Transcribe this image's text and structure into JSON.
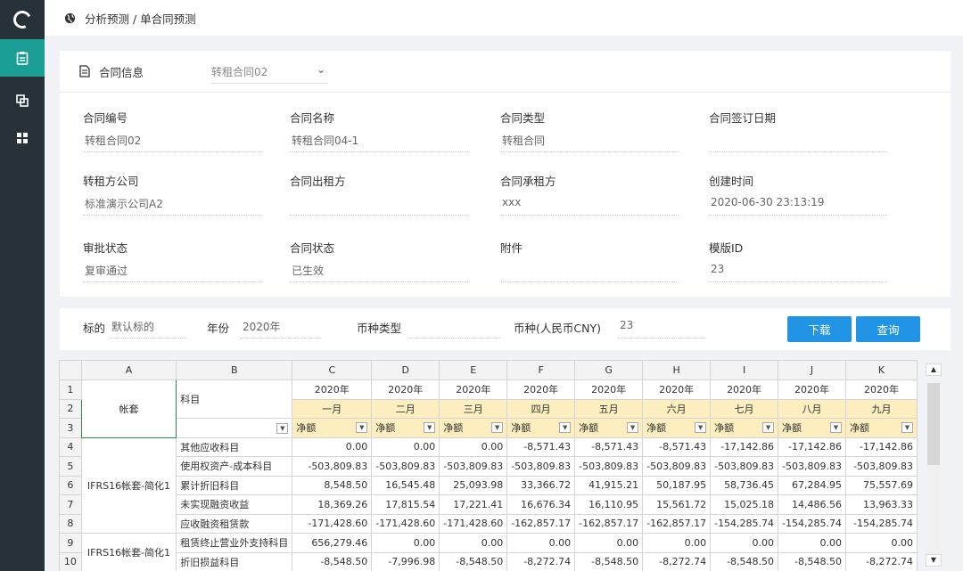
{
  "breadcrumb": "分析预测 / 单合同预测",
  "contract_card": {
    "title": "合同信息",
    "selector_value": "转租合同02",
    "fields": [
      {
        "label": "合同编号",
        "value": "转租合同02"
      },
      {
        "label": "合同名称",
        "value": "转租合同04-1"
      },
      {
        "label": "合同类型",
        "value": "转租合同"
      },
      {
        "label": "合同签订日期",
        "value": ""
      },
      {
        "label": "转租方公司",
        "value": "标准演示公司A2"
      },
      {
        "label": "合同出租方",
        "value": ""
      },
      {
        "label": "合同承租方",
        "value": "xxx"
      },
      {
        "label": "创建时间",
        "value": "2020-06-30 23:13:19"
      },
      {
        "label": "审批状态",
        "value": "复审通过"
      },
      {
        "label": "合同状态",
        "value": "已生效"
      },
      {
        "label": "附件",
        "value": ""
      },
      {
        "label": "模版ID",
        "value": "23"
      }
    ]
  },
  "filters": {
    "target_label": "标的",
    "target_value": "默认标的",
    "year_label": "年份",
    "year_value": "2020年",
    "currency_type_label": "币种类型",
    "currency_type_value": "",
    "currency_label": "币种(人民币CNY)",
    "currency_value": "23",
    "download_label": "下载",
    "query_label": "查询"
  },
  "sheet": {
    "columns": [
      "A",
      "B",
      "C",
      "D",
      "E",
      "F",
      "G",
      "H",
      "I",
      "J",
      "K"
    ],
    "row_numbers": [
      "1",
      "2",
      "3",
      "4",
      "5",
      "6",
      "7",
      "8",
      "9",
      "10"
    ],
    "a_header": "帐套",
    "b_header": "科目",
    "years": [
      "2020年",
      "2020年",
      "2020年",
      "2020年",
      "2020年",
      "2020年",
      "2020年",
      "2020年",
      "2020年"
    ],
    "months": [
      "一月",
      "二月",
      "三月",
      "四月",
      "五月",
      "六月",
      "七月",
      "八月",
      "九月"
    ],
    "measures": [
      "净额",
      "净额",
      "净额",
      "净额",
      "净额",
      "净额",
      "净额",
      "净额",
      "净额"
    ],
    "group1": "IFRS16帐套-简化1",
    "group2": "IFRS16帐套-简化1",
    "rows": [
      {
        "subject": "其他应收科目",
        "values": [
          "0.00",
          "0.00",
          "0.00",
          "-8,571.43",
          "-8,571.43",
          "-8,571.43",
          "-17,142.86",
          "-17,142.86",
          "-17,142.86"
        ]
      },
      {
        "subject": "使用权资产-成本科目",
        "values": [
          "-503,809.83",
          "-503,809.83",
          "-503,809.83",
          "-503,809.83",
          "-503,809.83",
          "-503,809.83",
          "-503,809.83",
          "-503,809.83",
          "-503,809.83"
        ]
      },
      {
        "subject": "累计折旧科目",
        "values": [
          "8,548.50",
          "16,545.48",
          "25,093.98",
          "33,366.72",
          "41,915.21",
          "50,187.95",
          "58,736.45",
          "67,284.95",
          "75,557.69"
        ]
      },
      {
        "subject": "未实现融资收益",
        "values": [
          "18,369.26",
          "17,815.54",
          "17,221.41",
          "16,676.34",
          "16,110.95",
          "15,561.72",
          "15,025.18",
          "14,486.56",
          "13,963.33"
        ]
      },
      {
        "subject": "应收融资租赁款",
        "values": [
          "-171,428.60",
          "-171,428.60",
          "-171,428.60",
          "-162,857.17",
          "-162,857.17",
          "-162,857.17",
          "-154,285.74",
          "-154,285.74",
          "-154,285.74"
        ]
      },
      {
        "subject": "租赁终止营业外支持科目",
        "values": [
          "656,279.46",
          "0.00",
          "0.00",
          "0.00",
          "0.00",
          "0.00",
          "0.00",
          "0.00",
          "0.00"
        ]
      },
      {
        "subject": "折旧损益科目",
        "values": [
          "-8,548.50",
          "-7,996.98",
          "-8,548.50",
          "-8,272.74",
          "-8,548.50",
          "-8,272.74",
          "-8,548.50",
          "-8,548.50",
          "-8,272.74"
        ]
      }
    ]
  },
  "colors": {
    "sidebar": "#273238",
    "active_nav": "#1b9e95",
    "button": "#2194e6",
    "header_fill": "#fdeebf"
  }
}
